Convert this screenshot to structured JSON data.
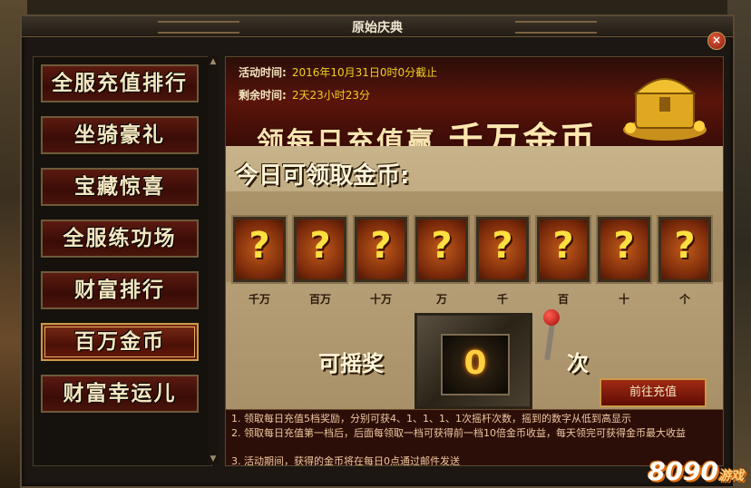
{
  "window": {
    "title": "原始庆典",
    "close_label": "×"
  },
  "sidebar": {
    "items": [
      {
        "label": "全服充值排行"
      },
      {
        "label": "坐骑豪礼"
      },
      {
        "label": "宝藏惊喜"
      },
      {
        "label": "全服练功场"
      },
      {
        "label": "财富排行"
      },
      {
        "label": "百万金币",
        "active": true
      },
      {
        "label": "财富幸运儿"
      }
    ],
    "scroll_up": "▲",
    "scroll_down": "▼"
  },
  "banner": {
    "activity_time_label": "活动时间:",
    "activity_time_value": "2016年10月31日0时0分截止",
    "remaining_label": "剩余时间:",
    "remaining_value": "2天23小时23分",
    "slogan_a": "领每日充值赢",
    "slogan_b": "千万金币"
  },
  "today": {
    "label": "今日可领取金币:",
    "digits": [
      {
        "value": "?",
        "label": "千万"
      },
      {
        "value": "?",
        "label": "百万"
      },
      {
        "value": "?",
        "label": "十万"
      },
      {
        "value": "?",
        "label": "万"
      },
      {
        "value": "?",
        "label": "千"
      },
      {
        "value": "?",
        "label": "百"
      },
      {
        "value": "?",
        "label": "十"
      },
      {
        "value": "?",
        "label": "个"
      }
    ]
  },
  "slot": {
    "label_left": "可摇奖",
    "count": "0",
    "label_right": "次",
    "recharge_button": "前往充值"
  },
  "rules": [
    "1. 领取每日充值5档奖励，分别可获4、1、1、1、1次摇杆次数，摇到的数字从低到高显示",
    "2. 领取每日充值第一档后，后面每领取一档可获得前一档10倍金币收益，每天领完可获得金币最大收益",
    "3. 活动期间，获得的金币将在每日0点通过邮件发送"
  ],
  "watermark": {
    "brand": "8090",
    "suffix": "游戏"
  },
  "colors": {
    "accent_gold": "#f0d020",
    "banner_red": "#5a140a"
  }
}
